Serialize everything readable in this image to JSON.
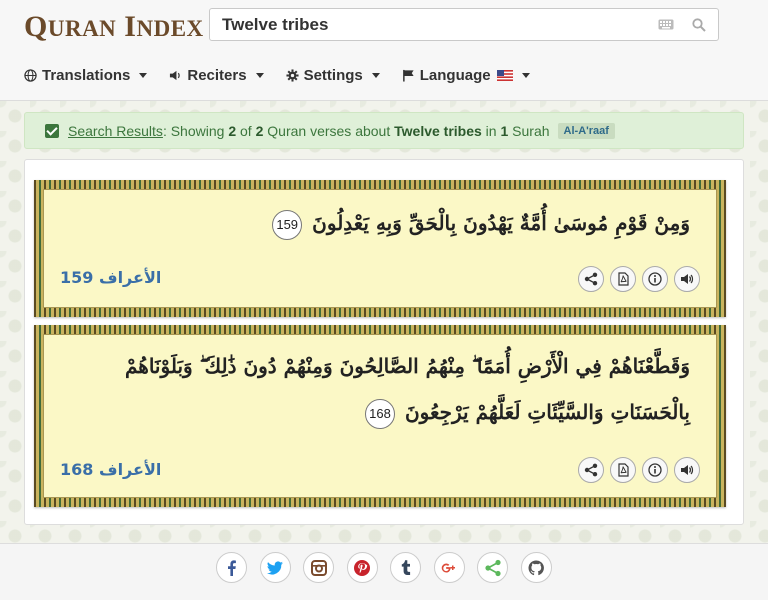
{
  "logo": {
    "word1_initial": "Q",
    "word1_rest": "URAN",
    "word2_initial": "I",
    "word2_rest": "NDEX"
  },
  "search": {
    "value": "Twelve tribes"
  },
  "nav": {
    "translations": "Translations",
    "reciters": "Reciters",
    "settings": "Settings",
    "language": "Language"
  },
  "result": {
    "link": "Search Results",
    "showing": ": Showing ",
    "count": "2",
    "of": " of ",
    "total": "2",
    "mid": " Quran verses about ",
    "query": "Twelve tribes",
    "in": " in ",
    "surah_count": "1",
    "surah_word": " Surah",
    "badge": "Al-A'raaf"
  },
  "verses": [
    {
      "text": "وَمِنْ قَوْمِ مُوسَىٰ أُمَّةٌ يَهْدُونَ بِالْحَقِّ وَبِهِ يَعْدِلُونَ",
      "number": "159",
      "ref_surah": "الأعراف",
      "ref_num": "159"
    },
    {
      "text": "وَقَطَّعْنَاهُمْ فِي الْأَرْضِ أُمَمًا ۖ مِنْهُمُ الصَّالِحُونَ وَمِنْهُمْ دُونَ ذَٰلِكَ ۖ وَبَلَوْنَاهُمْ بِالْحَسَنَاتِ وَالسَّيِّئَاتِ لَعَلَّهُمْ يَرْجِعُونَ",
      "number": "168",
      "ref_surah": "الأعراف",
      "ref_num": "168"
    }
  ],
  "colors": {
    "accent": "#3a6fa8",
    "success": "#3c763d",
    "logo": "#6b4a2a"
  }
}
